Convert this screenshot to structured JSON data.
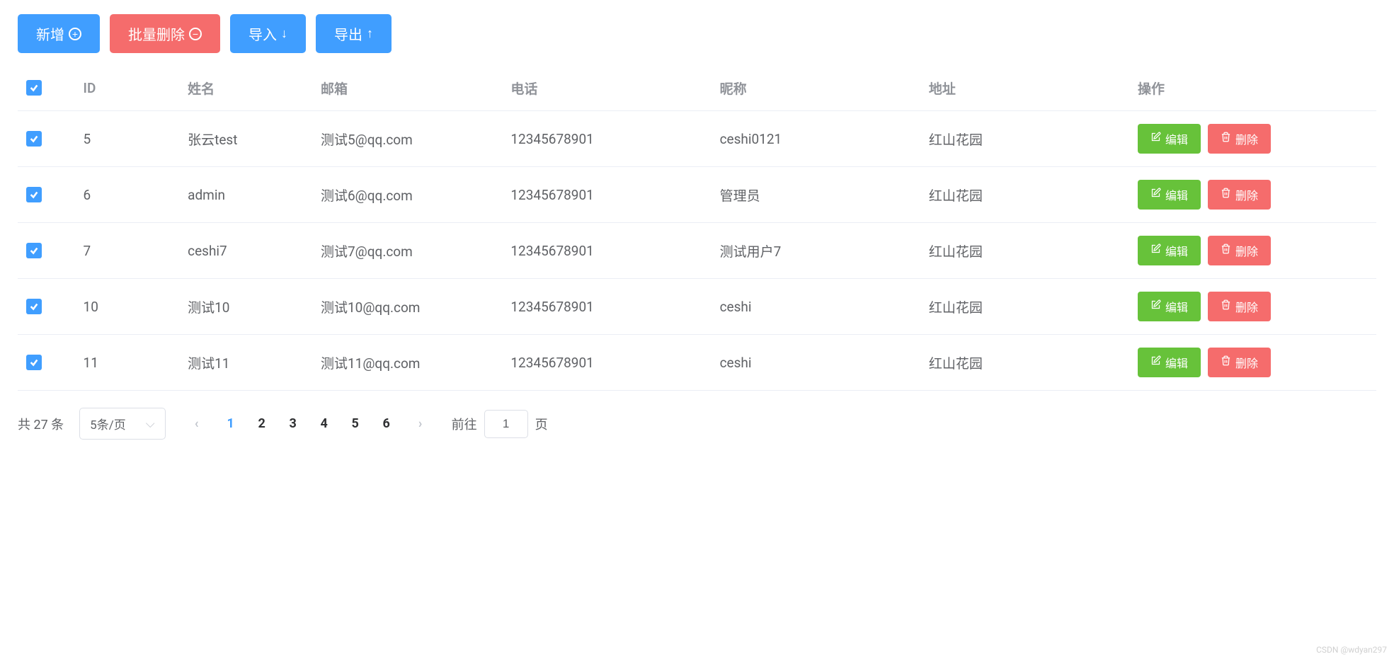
{
  "toolbar": {
    "add_label": "新增",
    "batch_delete_label": "批量删除",
    "import_label": "导入",
    "export_label": "导出"
  },
  "table": {
    "headers": {
      "id": "ID",
      "name": "姓名",
      "email": "邮箱",
      "phone": "电话",
      "nickname": "昵称",
      "address": "地址",
      "actions": "操作"
    },
    "rows": [
      {
        "id": "5",
        "name": "张云test",
        "email": "测试5@qq.com",
        "phone": "12345678901",
        "nickname": "ceshi0121",
        "address": "红山花园"
      },
      {
        "id": "6",
        "name": "admin",
        "email": "测试6@qq.com",
        "phone": "12345678901",
        "nickname": "管理员",
        "address": "红山花园"
      },
      {
        "id": "7",
        "name": "ceshi7",
        "email": "测试7@qq.com",
        "phone": "12345678901",
        "nickname": "测试用户7",
        "address": "红山花园"
      },
      {
        "id": "10",
        "name": "测试10",
        "email": "测试10@qq.com",
        "phone": "12345678901",
        "nickname": "ceshi",
        "address": "红山花园"
      },
      {
        "id": "11",
        "name": "测试11",
        "email": "测试11@qq.com",
        "phone": "12345678901",
        "nickname": "ceshi",
        "address": "红山花园"
      }
    ],
    "edit_label": "编辑",
    "delete_label": "删除"
  },
  "pagination": {
    "total_label": "共 27 条",
    "page_size_label": "5条/页",
    "pages": [
      "1",
      "2",
      "3",
      "4",
      "5",
      "6"
    ],
    "current_page": "1",
    "jump_prefix": "前往",
    "jump_value": "1",
    "jump_suffix": "页"
  },
  "watermark": "CSDN @wdyan297"
}
